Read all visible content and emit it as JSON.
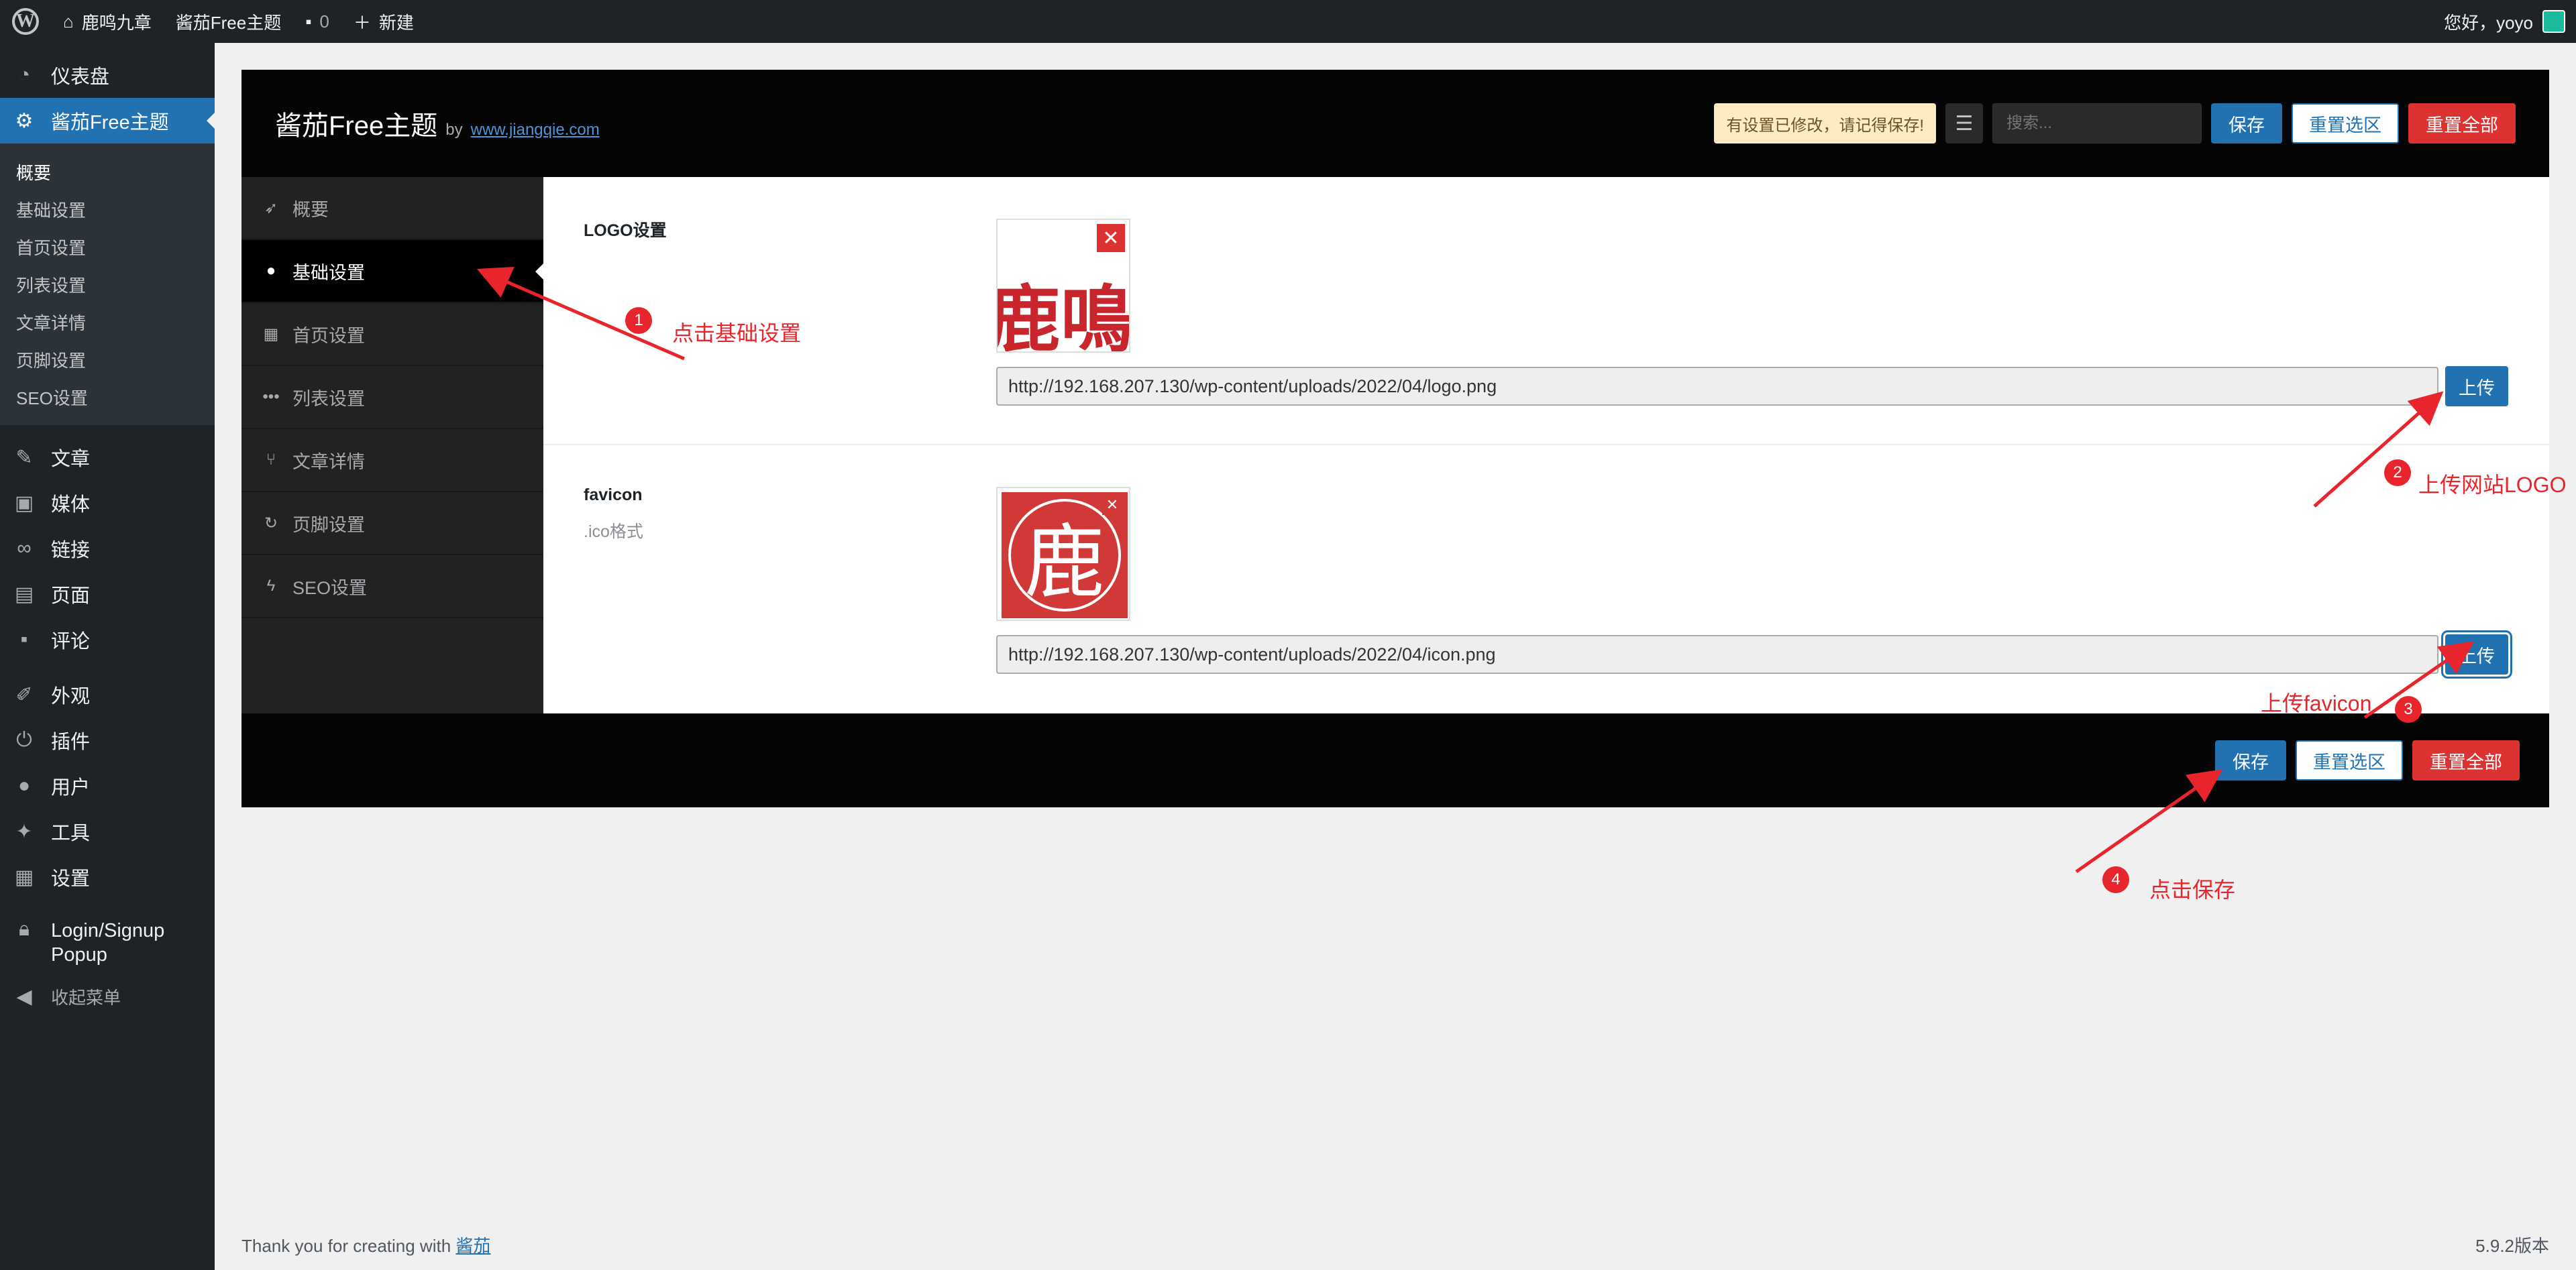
{
  "admin_bar": {
    "site_name": "鹿鸣九章",
    "theme_menu": "酱茄Free主题",
    "comments_count": "0",
    "new_label": "新建",
    "greeting": "您好，yoyo"
  },
  "sidebar": {
    "dashboard": "仪表盘",
    "theme": "酱茄Free主题",
    "submenu": [
      "概要",
      "基础设置",
      "首页设置",
      "列表设置",
      "文章详情",
      "页脚设置",
      "SEO设置"
    ],
    "items": [
      "文章",
      "媒体",
      "链接",
      "页面",
      "评论",
      "外观",
      "插件",
      "用户",
      "工具",
      "设置"
    ],
    "login_popup": "Login/Signup Popup",
    "collapse": "收起菜单"
  },
  "panel": {
    "title": "酱茄Free主题",
    "by": "by",
    "link": "www.jiangqie.com",
    "notice": "有设置已修改，请记得保存!",
    "search_placeholder": "搜索...",
    "save": "保存",
    "reset_section": "重置选区",
    "reset_all": "重置全部",
    "tabs": [
      "概要",
      "基础设置",
      "首页设置",
      "列表设置",
      "文章详情",
      "页脚设置",
      "SEO设置"
    ],
    "fields": {
      "logo": {
        "label": "LOGO设置",
        "image_text": "鹿鳴九",
        "url": "http://192.168.207.130/wp-content/uploads/2022/04/logo.png",
        "upload": "上传"
      },
      "favicon": {
        "label": "favicon",
        "sub": ".ico格式",
        "image_text": "鹿",
        "url": "http://192.168.207.130/wp-content/uploads/2022/04/icon.png",
        "upload": "上传"
      }
    }
  },
  "annotations": {
    "a1": {
      "num": "1",
      "text": "点击基础设置"
    },
    "a2": {
      "num": "2",
      "text": "上传网站LOGO"
    },
    "a3": {
      "num": "3",
      "text": "上传favicon"
    },
    "a4": {
      "num": "4",
      "text": "点击保存"
    }
  },
  "footer": {
    "thanks": "Thank you for creating with",
    "link": "酱茄",
    "version": "5.9.2版本"
  },
  "colors": {
    "accent": "#2271b1",
    "danger": "#dc3232",
    "annotation": "#e8252c"
  }
}
